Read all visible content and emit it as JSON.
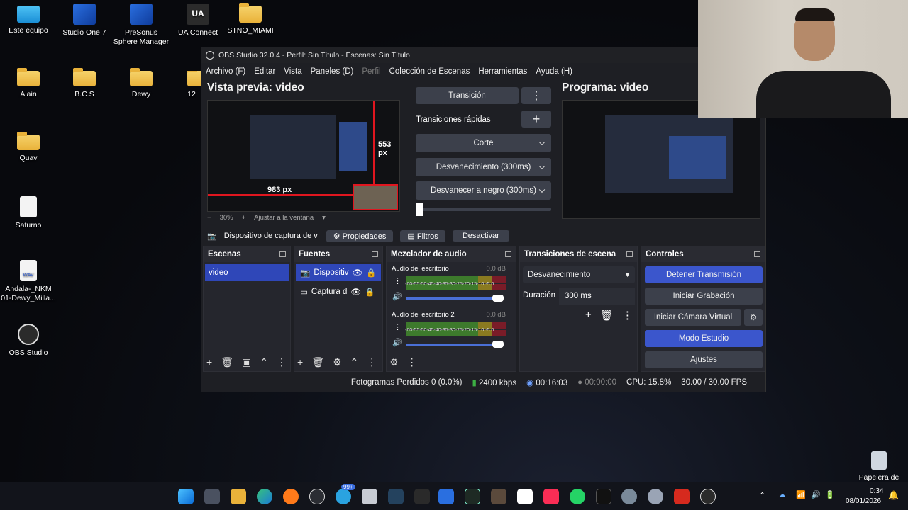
{
  "desktop": {
    "icons": [
      {
        "label": "Este equipo",
        "kind": "monitor"
      },
      {
        "label": "Studio One 7",
        "kind": "app"
      },
      {
        "label": "PreSonus Sphere Manager",
        "kind": "app"
      },
      {
        "label": "UA Connect",
        "kind": "ua"
      },
      {
        "label": "STNO_MIAMI",
        "kind": "folder"
      },
      {
        "label": "Alain",
        "kind": "folder"
      },
      {
        "label": "B.C.S",
        "kind": "folder"
      },
      {
        "label": "Dewy",
        "kind": "folder"
      },
      {
        "label": "12",
        "kind": "folder"
      },
      {
        "label": "Quav",
        "kind": "folder"
      },
      {
        "label": "Saturno",
        "kind": "file"
      },
      {
        "label": "Andala-_NKM 01-Dewy_Milla...",
        "kind": "wav"
      },
      {
        "label": "OBS Studio",
        "kind": "obs"
      },
      {
        "label": "Papelera de",
        "kind": "recycle"
      }
    ],
    "ua_badge": "UA",
    "wav_badge": "WAV"
  },
  "obs": {
    "title": "OBS Studio 32.0.4 - Perfil: Sin Título - Escenas: Sin Título",
    "menu": [
      "Archivo (F)",
      "Editar",
      "Vista",
      "Paneles (D)",
      "Perfil",
      "Colección de Escenas",
      "Herramientas",
      "Ayuda (H)"
    ],
    "preview_title": "Vista previa: video",
    "program_title": "Programa: video",
    "measure_h": "983 px",
    "measure_v": "553 px",
    "zoom": "30%",
    "fit": "Ajustar a la ventana",
    "transition_btn": "Transición",
    "quick_transitions": "Transiciones rápidas",
    "quick": [
      "Corte",
      "Desvanecimiento (300ms)",
      "Desvanecer a negro (300ms)"
    ],
    "source_name": "Dispositivo de captura de v",
    "props": "Propiedades",
    "filters": "Filtros",
    "deactivate": "Desactivar",
    "docks": {
      "scenes": {
        "title": "Escenas",
        "items": [
          "video"
        ]
      },
      "sources": {
        "title": "Fuentes",
        "items": [
          "Dispositiv",
          "Captura d"
        ]
      },
      "mixer": {
        "title": "Mezclador de audio",
        "channels": [
          {
            "name": "Audio del escritorio",
            "db": "0.0 dB"
          },
          {
            "name": "Audio del escritorio 2",
            "db": "0.0 dB"
          }
        ],
        "scale": "-60-55-50-45-40-35-30-25-20-15-10 -5 0"
      },
      "transitions": {
        "title": "Transiciones de escena",
        "selected": "Desvanecimiento",
        "duration_label": "Duración",
        "duration": "300 ms"
      },
      "controls": {
        "title": "Controles",
        "buttons": [
          "Detener Transmisión",
          "Iniciar Grabación",
          "Iniciar Cámara Virtual",
          "Modo Estudio",
          "Ajustes"
        ]
      }
    },
    "status": {
      "dropped": "Fotogramas Perdidos 0 (0.0%)",
      "bitrate": "2400 kbps",
      "stream_time": "00:16:03",
      "rec_time": "00:00:00",
      "cpu": "CPU: 15.8%",
      "fps": "30.00 / 30.00 FPS"
    }
  },
  "taskbar": {
    "time": "0:34",
    "date": "08/01/2026",
    "badge": "99+"
  },
  "colors": {
    "accent": "#3b56cc",
    "active": "#2f47b8"
  }
}
